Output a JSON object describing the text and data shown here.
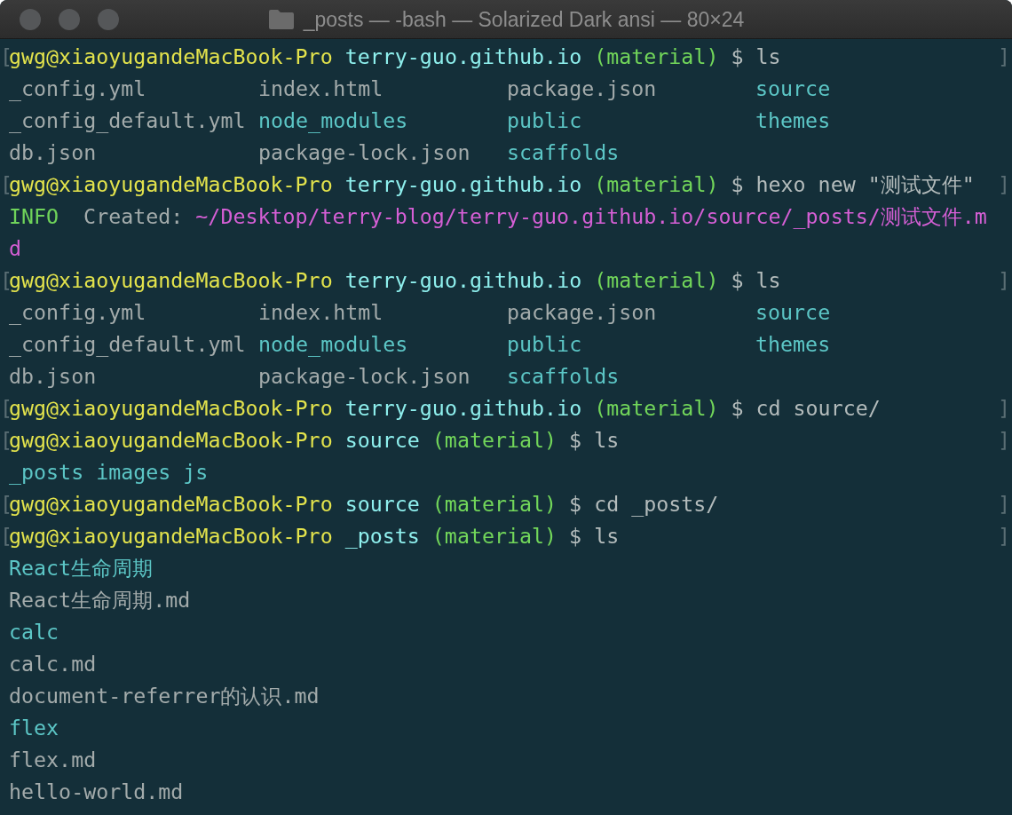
{
  "window": {
    "title": "_posts — -bash — Solarized Dark ansi — 80×24"
  },
  "lines": [
    {
      "kind": "prompt",
      "open_mark": "[",
      "user": "gwg@xiaoyugandeMacBook-Pro",
      "dir": "terry-guo.github.io",
      "branch": "(material)",
      "symbol": "$",
      "command": "ls",
      "close_mark": "]"
    },
    {
      "kind": "columns",
      "items": [
        {
          "text": "_config.yml",
          "kind": "file"
        },
        {
          "text": "index.html",
          "kind": "file"
        },
        {
          "text": "package.json",
          "kind": "file"
        },
        {
          "text": "source",
          "kind": "folder"
        }
      ]
    },
    {
      "kind": "columns",
      "items": [
        {
          "text": "_config_default.yml",
          "kind": "file"
        },
        {
          "text": "node_modules",
          "kind": "folder"
        },
        {
          "text": "public",
          "kind": "folder"
        },
        {
          "text": "themes",
          "kind": "folder"
        }
      ]
    },
    {
      "kind": "columns",
      "items": [
        {
          "text": "db.json",
          "kind": "file"
        },
        {
          "text": "package-lock.json",
          "kind": "file"
        },
        {
          "text": "scaffolds",
          "kind": "folder"
        }
      ]
    },
    {
      "kind": "prompt",
      "open_mark": "[",
      "user": "gwg@xiaoyugandeMacBook-Pro",
      "dir": "terry-guo.github.io",
      "branch": "(material)",
      "symbol": "$",
      "command": "hexo new \"测试文件\"",
      "close_mark": "]"
    },
    {
      "kind": "info",
      "label": "INFO",
      "message": "Created:",
      "path": "~/Desktop/terry-blog/terry-guo.github.io/source/_posts/测试文件.m"
    },
    {
      "kind": "continuation",
      "text": "d"
    },
    {
      "kind": "prompt",
      "open_mark": "[",
      "user": "gwg@xiaoyugandeMacBook-Pro",
      "dir": "terry-guo.github.io",
      "branch": "(material)",
      "symbol": "$",
      "command": "ls",
      "close_mark": "]"
    },
    {
      "kind": "columns",
      "items": [
        {
          "text": "_config.yml",
          "kind": "file"
        },
        {
          "text": "index.html",
          "kind": "file"
        },
        {
          "text": "package.json",
          "kind": "file"
        },
        {
          "text": "source",
          "kind": "folder"
        }
      ]
    },
    {
      "kind": "columns",
      "items": [
        {
          "text": "_config_default.yml",
          "kind": "file"
        },
        {
          "text": "node_modules",
          "kind": "folder"
        },
        {
          "text": "public",
          "kind": "folder"
        },
        {
          "text": "themes",
          "kind": "folder"
        }
      ]
    },
    {
      "kind": "columns",
      "items": [
        {
          "text": "db.json",
          "kind": "file"
        },
        {
          "text": "package-lock.json",
          "kind": "file"
        },
        {
          "text": "scaffolds",
          "kind": "folder"
        }
      ]
    },
    {
      "kind": "prompt",
      "open_mark": "[",
      "user": "gwg@xiaoyugandeMacBook-Pro",
      "dir": "terry-guo.github.io",
      "branch": "(material)",
      "symbol": "$",
      "command": "cd source/",
      "close_mark": "]"
    },
    {
      "kind": "prompt",
      "open_mark": "[",
      "user": "gwg@xiaoyugandeMacBook-Pro",
      "dir": "source",
      "branch": "(material)",
      "symbol": "$",
      "command": "ls",
      "close_mark": "]"
    },
    {
      "kind": "row",
      "items": [
        {
          "text": "_posts",
          "kind": "folder"
        },
        {
          "text": "images",
          "kind": "folder"
        },
        {
          "text": "js",
          "kind": "folder"
        }
      ]
    },
    {
      "kind": "prompt",
      "open_mark": "[",
      "user": "gwg@xiaoyugandeMacBook-Pro",
      "dir": "source",
      "branch": "(material)",
      "symbol": "$",
      "command": "cd _posts/",
      "close_mark": "]"
    },
    {
      "kind": "prompt",
      "open_mark": "[",
      "user": "gwg@xiaoyugandeMacBook-Pro",
      "dir": "_posts",
      "branch": "(material)",
      "symbol": "$",
      "command": "ls",
      "close_mark": "]"
    },
    {
      "kind": "row",
      "items": [
        {
          "text": "React生命周期",
          "kind": "folder"
        }
      ]
    },
    {
      "kind": "row",
      "items": [
        {
          "text": "React生命周期.md",
          "kind": "file"
        }
      ]
    },
    {
      "kind": "row",
      "items": [
        {
          "text": "calc",
          "kind": "folder"
        }
      ]
    },
    {
      "kind": "row",
      "items": [
        {
          "text": "calc.md",
          "kind": "file"
        }
      ]
    },
    {
      "kind": "row",
      "items": [
        {
          "text": "document-referrer的认识.md",
          "kind": "file"
        }
      ]
    },
    {
      "kind": "row",
      "items": [
        {
          "text": "flex",
          "kind": "folder"
        }
      ]
    },
    {
      "kind": "row",
      "items": [
        {
          "text": "flex.md",
          "kind": "file"
        }
      ]
    },
    {
      "kind": "row",
      "items": [
        {
          "text": "hello-world.md",
          "kind": "file"
        }
      ]
    }
  ]
}
